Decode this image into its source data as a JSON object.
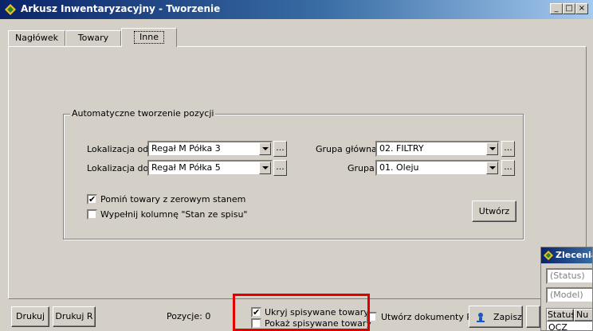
{
  "window": {
    "title": "Arkusz Inwentaryzacyjny - Tworzenie",
    "controls": [
      "_",
      "□",
      "×"
    ]
  },
  "tabs": [
    {
      "label": "Nagłówek"
    },
    {
      "label": "Towary"
    },
    {
      "label": "Inne",
      "active": true
    }
  ],
  "auto_group": {
    "title": "Automatyczne tworzenie pozycji",
    "lokalizacja_od_label": "Lokalizacja od:",
    "lokalizacja_od_value": "Regał M Półka 3",
    "lokalizacja_do_label": "Lokalizacja do:",
    "lokalizacja_do_value": "Regał M Półka 5",
    "grupa_glowna_label": "Grupa główna:",
    "grupa_glowna_value": "02. FILTRY",
    "grupa_label": "Grupa:",
    "grupa_value": "01. Oleju",
    "dots_label": "...",
    "skip_zero_label": "Pomiń towary z zerowym stanem",
    "skip_zero_checked": true,
    "fill_column_label": "Wypełnij kolumnę \"Stan ze spisu\"",
    "fill_column_checked": false,
    "create_button": "Utwórz"
  },
  "bottom": {
    "print_button": "Drukuj",
    "print_r_button": "Drukuj R",
    "positions_label": "Pozycje: 0",
    "hide_listed_label": "Ukryj spisywane towary",
    "hide_listed_checked": true,
    "show_listed_label": "Pokaż spisywane towary",
    "show_listed_checked": false,
    "create_docs_label": "Utwórz dokumenty RI",
    "create_docs_checked": false,
    "save_button": "Zapisz"
  },
  "child_window": {
    "title": "Zlecenia",
    "status_filter": "(Status)",
    "model_filter": "(Model)",
    "col_status": "Status",
    "col_nr": "Nu",
    "row_status": "OCZ"
  },
  "colors": {
    "titlebar_start": "#0a246a",
    "titlebar_end": "#a6caf0",
    "face": "#d4d0c8",
    "highlight_box": "#e00000"
  },
  "icons": [
    "app-icon",
    "combo-arrow-icon",
    "save-icon"
  ]
}
